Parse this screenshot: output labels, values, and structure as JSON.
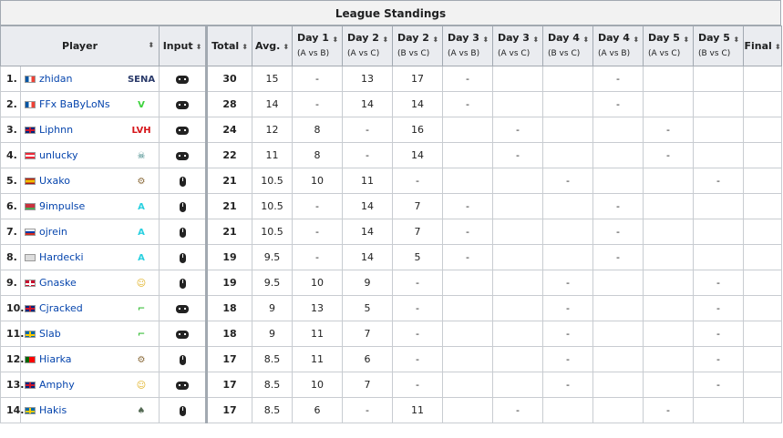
{
  "title": "League Standings",
  "headers": {
    "player": "Player",
    "input": "Input",
    "total": "Total",
    "avg": "Avg.",
    "days": [
      {
        "label": "Day 1",
        "sub": "(A vs B)"
      },
      {
        "label": "Day 2",
        "sub": "(A vs C)"
      },
      {
        "label": "Day 2",
        "sub": "(B vs C)"
      },
      {
        "label": "Day 3",
        "sub": "(A vs B)"
      },
      {
        "label": "Day 3",
        "sub": "(A vs C)"
      },
      {
        "label": "Day 4",
        "sub": "(B vs C)"
      },
      {
        "label": "Day 4",
        "sub": "(A vs B)"
      },
      {
        "label": "Day 5",
        "sub": "(A vs C)"
      },
      {
        "label": "Day 5",
        "sub": "(B vs C)"
      }
    ],
    "final": "Final",
    "sort_glyph": "⬍"
  },
  "rows": [
    {
      "rank": "1.",
      "name": "zhidan",
      "flag": "fr",
      "team": "SENA",
      "team_color": "#2a3a6a",
      "input": "controller",
      "total": "30",
      "avg": "15",
      "days": [
        "-",
        "13",
        "17",
        "-",
        "",
        "",
        "-",
        "",
        ""
      ]
    },
    {
      "rank": "2.",
      "name": "FFx BaByLoNs",
      "flag": "fr",
      "team": "V",
      "team_color": "#3bd23b",
      "input": "controller",
      "total": "28",
      "avg": "14",
      "days": [
        "-",
        "14",
        "14",
        "-",
        "",
        "",
        "-",
        "",
        ""
      ]
    },
    {
      "rank": "3.",
      "name": "Liphnn",
      "flag": "gb",
      "team": "LVH",
      "team_color": "#d6161b",
      "input": "controller",
      "total": "24",
      "avg": "12",
      "days": [
        "8",
        "-",
        "16",
        "",
        "-",
        "",
        "",
        "-",
        ""
      ]
    },
    {
      "rank": "4.",
      "name": "unlucky",
      "flag": "at",
      "team": "☠",
      "team_color": "#2a7a7a",
      "input": "controller",
      "total": "22",
      "avg": "11",
      "days": [
        "8",
        "-",
        "14",
        "",
        "-",
        "",
        "",
        "-",
        ""
      ]
    },
    {
      "rank": "5.",
      "name": "Uxako",
      "flag": "es",
      "team": "⚙",
      "team_color": "#8a6a3a",
      "input": "mouse",
      "total": "21",
      "avg": "10.5",
      "days": [
        "10",
        "11",
        "-",
        "",
        "",
        "-",
        "",
        "",
        "-"
      ]
    },
    {
      "rank": "6.",
      "name": "9impulse",
      "flag": "by",
      "team": "A",
      "team_color": "#2ad0e0",
      "input": "mouse",
      "total": "21",
      "avg": "10.5",
      "days": [
        "-",
        "14",
        "7",
        "-",
        "",
        "",
        "-",
        "",
        ""
      ]
    },
    {
      "rank": "7.",
      "name": "ojrein",
      "flag": "ru",
      "team": "A",
      "team_color": "#2ad0e0",
      "input": "mouse",
      "total": "21",
      "avg": "10.5",
      "days": [
        "-",
        "14",
        "7",
        "-",
        "",
        "",
        "-",
        "",
        ""
      ]
    },
    {
      "rank": "8.",
      "name": "Hardecki",
      "flag": "none",
      "team": "A",
      "team_color": "#2ad0e0",
      "input": "mouse",
      "total": "19",
      "avg": "9.5",
      "days": [
        "-",
        "14",
        "5",
        "-",
        "",
        "",
        "-",
        "",
        ""
      ]
    },
    {
      "rank": "9.",
      "name": "Gnaske",
      "flag": "dk",
      "team": "☺",
      "team_color": "#e0b020",
      "input": "mouse",
      "total": "19",
      "avg": "9.5",
      "days": [
        "10",
        "9",
        "-",
        "",
        "",
        "-",
        "",
        "",
        "-"
      ]
    },
    {
      "rank": "10.",
      "name": "Cjracked",
      "flag": "gb",
      "team": "⌐",
      "team_color": "#40c040",
      "input": "controller",
      "total": "18",
      "avg": "9",
      "days": [
        "13",
        "5",
        "-",
        "",
        "",
        "-",
        "",
        "",
        "-"
      ]
    },
    {
      "rank": "11.",
      "name": "Slab",
      "flag": "se",
      "team": "⌐",
      "team_color": "#40c040",
      "input": "controller",
      "total": "18",
      "avg": "9",
      "days": [
        "11",
        "7",
        "-",
        "",
        "",
        "-",
        "",
        "",
        "-"
      ]
    },
    {
      "rank": "12.",
      "name": "Hiarka",
      "flag": "pt",
      "team": "⚙",
      "team_color": "#8a6a3a",
      "input": "mouse",
      "total": "17",
      "avg": "8.5",
      "days": [
        "11",
        "6",
        "-",
        "",
        "",
        "-",
        "",
        "",
        "-"
      ]
    },
    {
      "rank": "13.",
      "name": "Amphy",
      "flag": "gb",
      "team": "☺",
      "team_color": "#e0b020",
      "input": "controller",
      "total": "17",
      "avg": "8.5",
      "days": [
        "10",
        "7",
        "-",
        "",
        "",
        "-",
        "",
        "",
        "-"
      ]
    },
    {
      "rank": "14.",
      "name": "Hakis",
      "flag": "se",
      "team": "♠",
      "team_color": "#556b55",
      "input": "mouse",
      "total": "17",
      "avg": "8.5",
      "days": [
        "6",
        "-",
        "11",
        "",
        "-",
        "",
        "",
        "-",
        ""
      ]
    }
  ]
}
